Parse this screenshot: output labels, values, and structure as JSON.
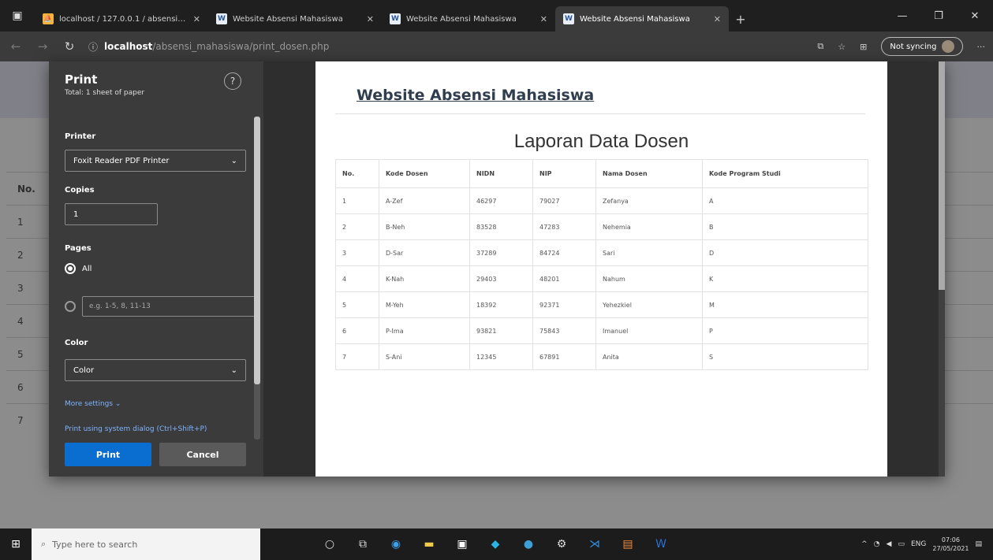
{
  "browser": {
    "tabs": [
      {
        "title": "localhost / 127.0.0.1 / absensi_m",
        "favicon": "pma"
      },
      {
        "title": "Website Absensi Mahasiswa",
        "favicon": "web"
      },
      {
        "title": "Website Absensi Mahasiswa",
        "favicon": "web"
      },
      {
        "title": "Website Absensi Mahasiswa",
        "favicon": "web",
        "active": true
      }
    ],
    "address": {
      "host": "localhost",
      "path": "/absensi_mahasiswa/print_dosen.php"
    },
    "sync_label": "Not syncing"
  },
  "background_page": {
    "column_header": "No.",
    "rows": [
      "1",
      "2",
      "3",
      "4",
      "5",
      "6",
      "7"
    ]
  },
  "print_panel": {
    "title": "Print",
    "subtitle": "Total: 1 sheet of paper",
    "help": "?",
    "printer_label": "Printer",
    "printer_value": "Foxit Reader PDF Printer",
    "copies_label": "Copies",
    "copies_value": "1",
    "pages_label": "Pages",
    "pages_all": "All",
    "pages_placeholder": "e.g. 1-5, 8, 11-13",
    "color_label": "Color",
    "color_value": "Color",
    "more_settings": "More settings",
    "system_dialog": "Print using system dialog (Ctrl+Shift+P)",
    "print_button": "Print",
    "cancel_button": "Cancel"
  },
  "preview": {
    "site_title": "Website Absensi Mahasiswa",
    "report_title": "Laporan Data Dosen",
    "headers": [
      "No.",
      "Kode Dosen",
      "NIDN",
      "NIP",
      "Nama Dosen",
      "Kode Program Studi"
    ],
    "rows": [
      [
        "1",
        "A-Zef",
        "46297",
        "79027",
        "Zefanya",
        "A"
      ],
      [
        "2",
        "B-Neh",
        "83528",
        "47283",
        "Nehemia",
        "B"
      ],
      [
        "3",
        "D-Sar",
        "37289",
        "84724",
        "Sari",
        "D"
      ],
      [
        "4",
        "K-Nah",
        "29403",
        "48201",
        "Nahum",
        "K"
      ],
      [
        "5",
        "M-Yeh",
        "18392",
        "92371",
        "Yehezkiel",
        "M"
      ],
      [
        "6",
        "P-Ima",
        "93821",
        "75843",
        "Imanuel",
        "P"
      ],
      [
        "7",
        "S-Ani",
        "12345",
        "67891",
        "Anita",
        "S"
      ]
    ]
  },
  "taskbar": {
    "search_placeholder": "Type here to search",
    "lang": "ENG",
    "time": "07:06",
    "date": "27/05/2021"
  }
}
